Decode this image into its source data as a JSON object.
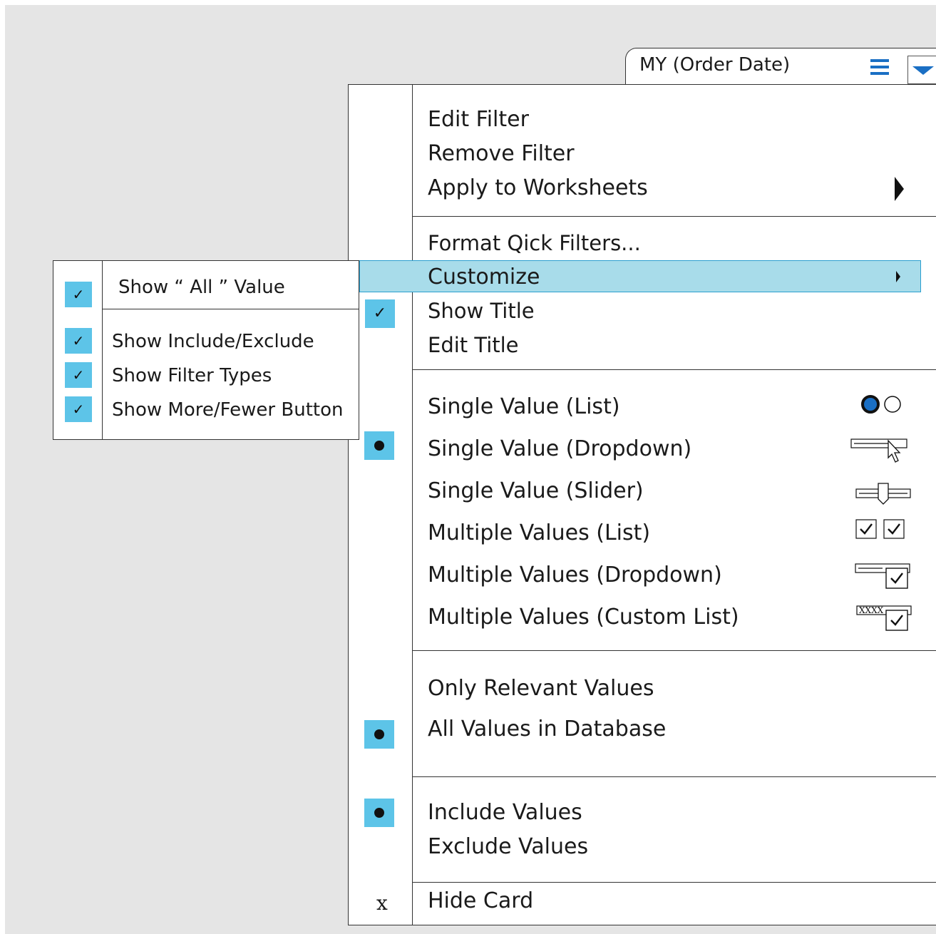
{
  "card": {
    "title": "MY (Order Date)",
    "icons": [
      "hamburger-icon",
      "dropdown-arrow-icon"
    ],
    "accent_color": "#1a6fc4"
  },
  "menu": {
    "group1": [
      "Edit Filter",
      "Remove Filter",
      "Apply to Worksheets"
    ],
    "group2": {
      "format": "Format Qick Filters...",
      "customize": "Customize",
      "show_title": "Show Title",
      "edit_title": "Edit Title"
    },
    "modes": [
      "Single Value  (List)",
      "Single Value  (Dropdown)",
      "Single Value  (Slider)",
      "Multiple Values (List)",
      "Multiple Values  (Dropdown)",
      "Multiple Values  (Custom List)"
    ],
    "custom_list_glyph": "XXXX",
    "values": [
      "Only Relevant Values",
      "All Values in Database"
    ],
    "include": [
      "Include Values",
      "Exclude Values"
    ],
    "hide": {
      "label": "Hide Card",
      "mark": "x"
    },
    "highlight_color": "#a8dcea",
    "mark_color": "#5dc4e8"
  },
  "submenu": {
    "items": [
      "Show “ All ” Value",
      "Show Include/Exclude",
      "Show Filter Types",
      "Show More/Fewer Button"
    ],
    "checked": [
      true,
      true,
      true,
      true
    ]
  },
  "check_glyph": "✓"
}
